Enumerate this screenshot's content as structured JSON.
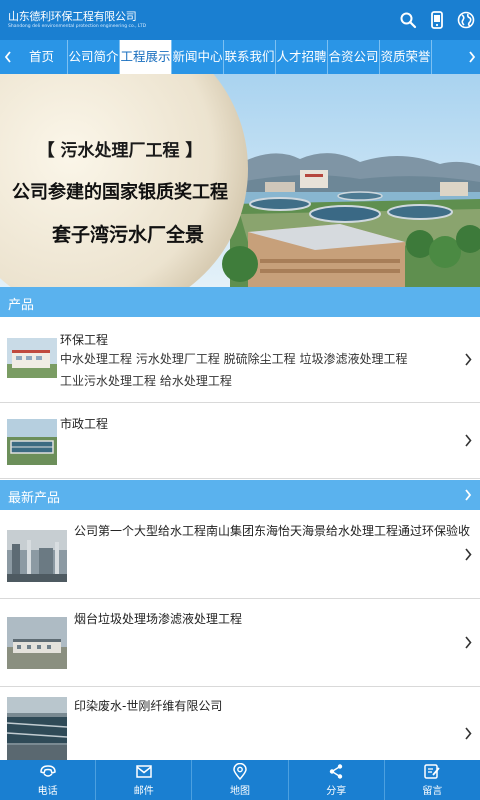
{
  "header": {
    "logo_cn": "山东德利环保工程有限公司",
    "logo_en": "Shandong deli environmental protection engineering co., LTD",
    "icons": [
      "search-icon",
      "phone-icon",
      "globe-icon"
    ]
  },
  "nav": {
    "items": [
      {
        "label": "首页",
        "active": false
      },
      {
        "label": "公司简介",
        "active": false
      },
      {
        "label": "工程展示",
        "active": true
      },
      {
        "label": "新闻中心",
        "active": false
      },
      {
        "label": "联系我们",
        "active": false
      },
      {
        "label": "人才招聘",
        "active": false
      },
      {
        "label": "合资公司",
        "active": false
      },
      {
        "label": "资质荣誉",
        "active": false
      }
    ]
  },
  "banner": {
    "line1": "【 污水处理厂工程 】",
    "line2": "公司参建的国家银质奖工程",
    "line3": "套子湾污水厂全景"
  },
  "products": {
    "title": "产品",
    "items": [
      {
        "title": "环保工程",
        "sub1": "中水处理工程  污水处理厂工程  脱硫除尘工程  垃圾渗滤液处理工程",
        "sub2": "工业污水处理工程  给水处理工程"
      },
      {
        "title": "市政工程"
      }
    ]
  },
  "latest": {
    "title": "最新产品",
    "items": [
      {
        "title": "公司第一个大型给水工程南山集团东海怡天海景给水处理工程通过环保验收"
      },
      {
        "title": "烟台垃圾处理场渗滤液处理工程"
      },
      {
        "title": "印染废水-世刚纤维有限公司"
      }
    ]
  },
  "bottom_tabs": [
    {
      "label": "电话",
      "icon": "phone-icon"
    },
    {
      "label": "邮件",
      "icon": "mail-icon"
    },
    {
      "label": "地图",
      "icon": "map-pin-icon"
    },
    {
      "label": "分享",
      "icon": "share-icon"
    },
    {
      "label": "留言",
      "icon": "edit-icon"
    }
  ],
  "colors": {
    "header": "#1a7fd1",
    "nav": "#2a95e6",
    "section": "#5ab2ee"
  }
}
